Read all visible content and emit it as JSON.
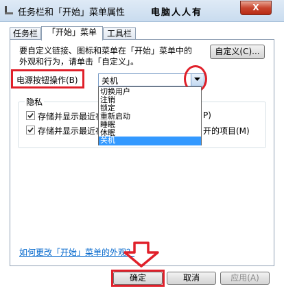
{
  "window": {
    "title": "任务栏和「开始」菜单属性",
    "watermark": "电脑人人有",
    "close_label": "X"
  },
  "tabs": [
    {
      "label": "任务栏"
    },
    {
      "label": "「开始」菜单"
    },
    {
      "label": "工具栏"
    }
  ],
  "start_menu": {
    "description_line1": "要自定义链接、图标和菜单在「开始」菜单中的",
    "description_line2": "外观和行为，请单击「自定义」。",
    "customize_label": "自定义(C)...",
    "power_button_label": "电源按钮操作(B)",
    "power_button_value": "关机",
    "power_options": [
      "切换用户",
      "注销",
      "锁定",
      "重新启动",
      "睡眠",
      "休眠",
      "关机"
    ],
    "selected_option": "关机"
  },
  "privacy": {
    "title": "隐私",
    "item1_label": "存储并显示最近在",
    "item1_suffix": "P)",
    "item2_label": "存储并显示最近在",
    "item2_suffix": "开的项目(M)"
  },
  "help_link": "如何更改「开始」菜单的外观？",
  "buttons": {
    "ok": "确定",
    "cancel": "取消",
    "apply": "应用(A)"
  },
  "colors": {
    "annotation_red": "#e0202a",
    "selection_blue": "#3399ff",
    "link_blue": "#0066cc"
  }
}
